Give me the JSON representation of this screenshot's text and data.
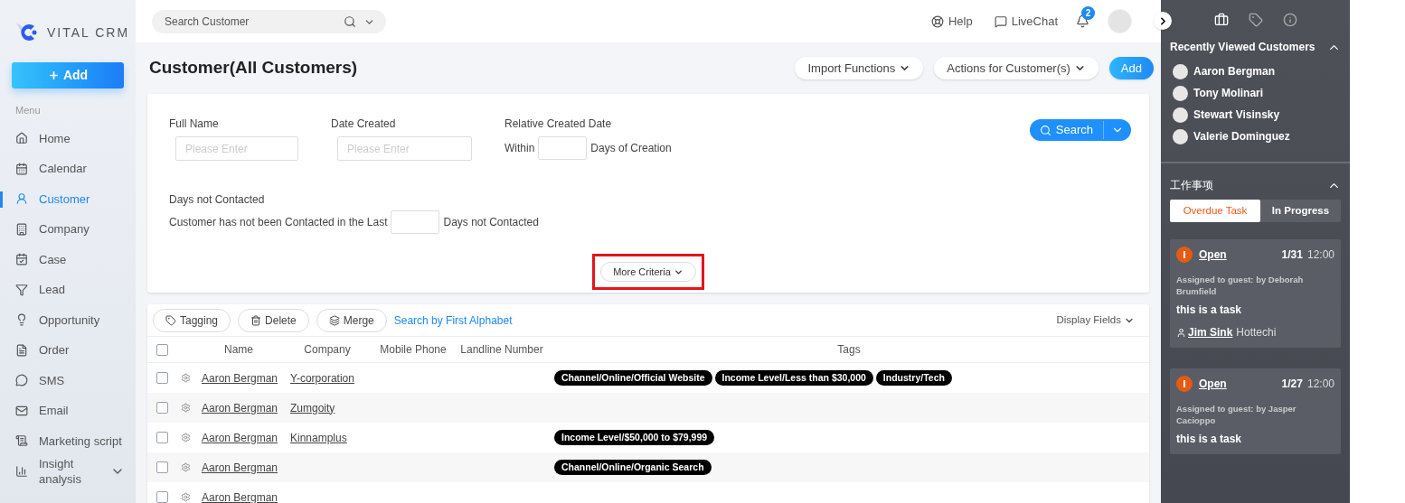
{
  "brand": {
    "name": "VITAL CRM"
  },
  "sidebar": {
    "add_button": "Add",
    "menu_label": "Menu",
    "items": [
      {
        "label": "Home",
        "kind": "link",
        "selected": false
      },
      {
        "label": "Calendar",
        "kind": "link",
        "selected": false
      },
      {
        "label": "Customer",
        "kind": "link",
        "selected": true
      },
      {
        "label": "Company",
        "kind": "link",
        "selected": false
      },
      {
        "label": "Case",
        "kind": "link",
        "selected": false
      },
      {
        "label": "Lead",
        "kind": "link",
        "selected": false
      },
      {
        "label": "Opportunity",
        "kind": "link",
        "selected": false
      },
      {
        "label": "Order",
        "kind": "link",
        "selected": false
      },
      {
        "label": "SMS",
        "kind": "link",
        "selected": false
      },
      {
        "label": "Email",
        "kind": "link",
        "selected": false
      },
      {
        "label": "Marketing script",
        "kind": "link",
        "selected": false
      },
      {
        "label": "Insight analysis",
        "kind": "group",
        "selected": false
      }
    ]
  },
  "topbar": {
    "search": {
      "placeholder": "Search Customer"
    },
    "help": "Help",
    "livechat": "LiveChat",
    "notification_count": "2"
  },
  "page": {
    "title": "Customer(All Customers)",
    "actions": [
      {
        "label": "Import Functions",
        "kind": "dropdown"
      },
      {
        "label": "Actions for Customer(s)",
        "kind": "dropdown"
      },
      {
        "label": "Add",
        "kind": "primary"
      }
    ]
  },
  "filters": {
    "fields": [
      {
        "label": "Full Name",
        "kind": "text",
        "placeholder": "Please Enter"
      },
      {
        "label": "Date Created",
        "kind": "text",
        "placeholder": "Please Enter"
      },
      {
        "label": "Relative Created Date",
        "kind": "inline",
        "prefix": "Within",
        "suffix": "Days of Creation"
      }
    ],
    "days_not_contacted": {
      "label": "Days not Contacted",
      "prefix": "Customer has not been Contacted in the Last",
      "suffix": "Days not Contacted"
    },
    "search_button": "Search",
    "more_criteria": {
      "label": "More Criteria",
      "highlighted": true
    }
  },
  "table": {
    "toolbar": [
      {
        "label": "Tagging",
        "kind": "tag"
      },
      {
        "label": "Delete",
        "kind": "delete"
      },
      {
        "label": "Merge",
        "kind": "merge"
      }
    ],
    "alphabet_link": "Search by First Alphabet",
    "display_fields": "Display Fields",
    "select_all": {
      "checked": false
    },
    "columns": [
      "Name",
      "Company",
      "Mobile Phone",
      "Landline Number",
      "Tags"
    ],
    "rows": [
      {
        "checked": false,
        "name": "Aaron Bergman",
        "company": "Y-corporation",
        "tags": [
          "Channel/Online/Official Website",
          "Income Level/Less than $30,000",
          "Industry/Tech"
        ]
      },
      {
        "checked": false,
        "name": "Aaron Bergman",
        "company": "Zumgoity",
        "tags": []
      },
      {
        "checked": false,
        "name": "Aaron Bergman",
        "company": "Kinnamplus",
        "tags": [
          "Income Level/$50,000 to $79,999"
        ]
      },
      {
        "checked": false,
        "name": "Aaron Bergman",
        "tags": [
          "Channel/Online/Organic Search"
        ]
      },
      {
        "checked": false,
        "name": "Aaron Bergman",
        "tags": []
      }
    ]
  },
  "right_panel": {
    "icon_tabs": [
      {
        "kind": "briefcase",
        "selected": true
      },
      {
        "kind": "tag",
        "selected": false
      },
      {
        "kind": "info",
        "selected": false
      }
    ],
    "recent": {
      "title": "Recently Viewed Customers",
      "expanded": true,
      "customers": [
        "Aaron Bergman",
        "Tony Molinari",
        "Stewart Visinsky",
        "Valerie Dominguez"
      ]
    },
    "tasks": {
      "title": "工作事项",
      "expanded": true,
      "tabs": [
        {
          "label": "Overdue Task",
          "selected": true
        },
        {
          "label": "In Progress",
          "selected": false
        }
      ],
      "items": [
        {
          "status": "Open",
          "date": "1/31",
          "time": "12:00",
          "assigned": "Assigned to guest: by Deborah Brumfield",
          "text": "this is a task",
          "contact": "Jim Sink",
          "company": "Hottechi"
        },
        {
          "status": "Open",
          "date": "1/27",
          "time": "12:00",
          "assigned": "Assigned to guest: by Jasper Cacioppo",
          "text": "this is a task"
        }
      ]
    }
  }
}
